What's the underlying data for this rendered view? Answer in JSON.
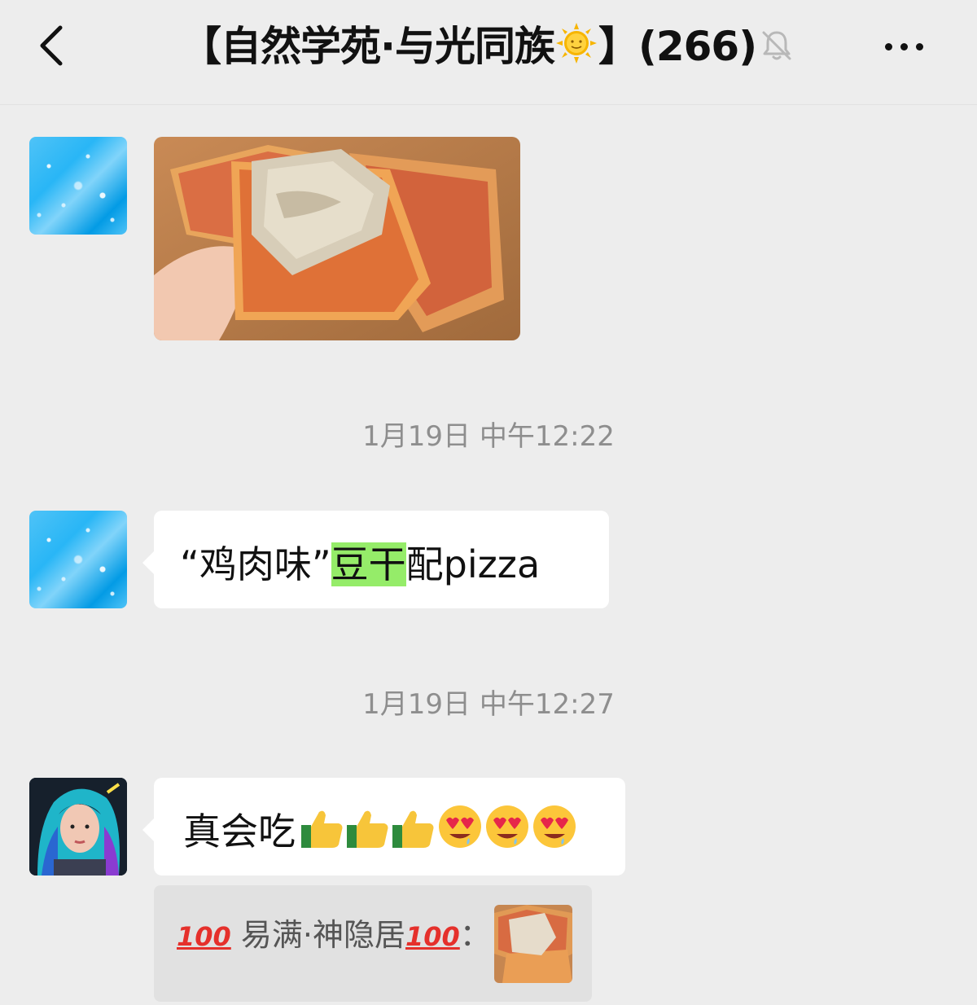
{
  "header": {
    "title_prefix": "【自然学苑·与光同族",
    "title_suffix": "】(266)",
    "back_icon": "chevron-left-icon",
    "mute_icon": "bell-muted-icon",
    "more_icon": "ellipsis-icon"
  },
  "messages": {
    "msg1": {
      "type": "image",
      "content": "pizza-with-dougan-photo"
    },
    "time1": "1月19日 中午12:22",
    "msg2": {
      "quote_open": "“鸡肉味”",
      "highlight": "豆干",
      "rest": "配pizza"
    },
    "time2": "1月19日 中午12:27",
    "msg3": {
      "text": "真会吃",
      "emoji": [
        "thumbs-up-icon",
        "thumbs-up-icon",
        "thumbs-up-icon",
        "heart-eyes-icon",
        "heart-eyes-icon",
        "heart-eyes-icon"
      ]
    },
    "quote": {
      "badge": "100",
      "name": "易满·神隐居",
      "colon": "："
    }
  },
  "colors": {
    "background": "#ededed",
    "bubble": "#ffffff",
    "highlight": "#95ec69",
    "timestamp": "#8e8e8e",
    "quote_bg": "#e1e1e1"
  }
}
